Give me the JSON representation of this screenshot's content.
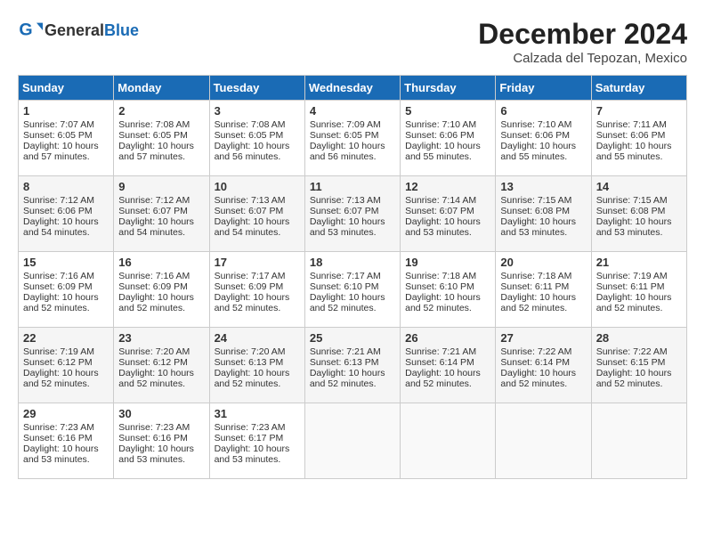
{
  "header": {
    "logo_general": "General",
    "logo_blue": "Blue",
    "main_title": "December 2024",
    "sub_title": "Calzada del Tepozan, Mexico"
  },
  "weekdays": [
    "Sunday",
    "Monday",
    "Tuesday",
    "Wednesday",
    "Thursday",
    "Friday",
    "Saturday"
  ],
  "weeks": [
    [
      {
        "day": "1",
        "sunrise": "Sunrise: 7:07 AM",
        "sunset": "Sunset: 6:05 PM",
        "daylight": "Daylight: 10 hours and 57 minutes."
      },
      {
        "day": "2",
        "sunrise": "Sunrise: 7:08 AM",
        "sunset": "Sunset: 6:05 PM",
        "daylight": "Daylight: 10 hours and 57 minutes."
      },
      {
        "day": "3",
        "sunrise": "Sunrise: 7:08 AM",
        "sunset": "Sunset: 6:05 PM",
        "daylight": "Daylight: 10 hours and 56 minutes."
      },
      {
        "day": "4",
        "sunrise": "Sunrise: 7:09 AM",
        "sunset": "Sunset: 6:05 PM",
        "daylight": "Daylight: 10 hours and 56 minutes."
      },
      {
        "day": "5",
        "sunrise": "Sunrise: 7:10 AM",
        "sunset": "Sunset: 6:06 PM",
        "daylight": "Daylight: 10 hours and 55 minutes."
      },
      {
        "day": "6",
        "sunrise": "Sunrise: 7:10 AM",
        "sunset": "Sunset: 6:06 PM",
        "daylight": "Daylight: 10 hours and 55 minutes."
      },
      {
        "day": "7",
        "sunrise": "Sunrise: 7:11 AM",
        "sunset": "Sunset: 6:06 PM",
        "daylight": "Daylight: 10 hours and 55 minutes."
      }
    ],
    [
      {
        "day": "8",
        "sunrise": "Sunrise: 7:12 AM",
        "sunset": "Sunset: 6:06 PM",
        "daylight": "Daylight: 10 hours and 54 minutes."
      },
      {
        "day": "9",
        "sunrise": "Sunrise: 7:12 AM",
        "sunset": "Sunset: 6:07 PM",
        "daylight": "Daylight: 10 hours and 54 minutes."
      },
      {
        "day": "10",
        "sunrise": "Sunrise: 7:13 AM",
        "sunset": "Sunset: 6:07 PM",
        "daylight": "Daylight: 10 hours and 54 minutes."
      },
      {
        "day": "11",
        "sunrise": "Sunrise: 7:13 AM",
        "sunset": "Sunset: 6:07 PM",
        "daylight": "Daylight: 10 hours and 53 minutes."
      },
      {
        "day": "12",
        "sunrise": "Sunrise: 7:14 AM",
        "sunset": "Sunset: 6:07 PM",
        "daylight": "Daylight: 10 hours and 53 minutes."
      },
      {
        "day": "13",
        "sunrise": "Sunrise: 7:15 AM",
        "sunset": "Sunset: 6:08 PM",
        "daylight": "Daylight: 10 hours and 53 minutes."
      },
      {
        "day": "14",
        "sunrise": "Sunrise: 7:15 AM",
        "sunset": "Sunset: 6:08 PM",
        "daylight": "Daylight: 10 hours and 53 minutes."
      }
    ],
    [
      {
        "day": "15",
        "sunrise": "Sunrise: 7:16 AM",
        "sunset": "Sunset: 6:09 PM",
        "daylight": "Daylight: 10 hours and 52 minutes."
      },
      {
        "day": "16",
        "sunrise": "Sunrise: 7:16 AM",
        "sunset": "Sunset: 6:09 PM",
        "daylight": "Daylight: 10 hours and 52 minutes."
      },
      {
        "day": "17",
        "sunrise": "Sunrise: 7:17 AM",
        "sunset": "Sunset: 6:09 PM",
        "daylight": "Daylight: 10 hours and 52 minutes."
      },
      {
        "day": "18",
        "sunrise": "Sunrise: 7:17 AM",
        "sunset": "Sunset: 6:10 PM",
        "daylight": "Daylight: 10 hours and 52 minutes."
      },
      {
        "day": "19",
        "sunrise": "Sunrise: 7:18 AM",
        "sunset": "Sunset: 6:10 PM",
        "daylight": "Daylight: 10 hours and 52 minutes."
      },
      {
        "day": "20",
        "sunrise": "Sunrise: 7:18 AM",
        "sunset": "Sunset: 6:11 PM",
        "daylight": "Daylight: 10 hours and 52 minutes."
      },
      {
        "day": "21",
        "sunrise": "Sunrise: 7:19 AM",
        "sunset": "Sunset: 6:11 PM",
        "daylight": "Daylight: 10 hours and 52 minutes."
      }
    ],
    [
      {
        "day": "22",
        "sunrise": "Sunrise: 7:19 AM",
        "sunset": "Sunset: 6:12 PM",
        "daylight": "Daylight: 10 hours and 52 minutes."
      },
      {
        "day": "23",
        "sunrise": "Sunrise: 7:20 AM",
        "sunset": "Sunset: 6:12 PM",
        "daylight": "Daylight: 10 hours and 52 minutes."
      },
      {
        "day": "24",
        "sunrise": "Sunrise: 7:20 AM",
        "sunset": "Sunset: 6:13 PM",
        "daylight": "Daylight: 10 hours and 52 minutes."
      },
      {
        "day": "25",
        "sunrise": "Sunrise: 7:21 AM",
        "sunset": "Sunset: 6:13 PM",
        "daylight": "Daylight: 10 hours and 52 minutes."
      },
      {
        "day": "26",
        "sunrise": "Sunrise: 7:21 AM",
        "sunset": "Sunset: 6:14 PM",
        "daylight": "Daylight: 10 hours and 52 minutes."
      },
      {
        "day": "27",
        "sunrise": "Sunrise: 7:22 AM",
        "sunset": "Sunset: 6:14 PM",
        "daylight": "Daylight: 10 hours and 52 minutes."
      },
      {
        "day": "28",
        "sunrise": "Sunrise: 7:22 AM",
        "sunset": "Sunset: 6:15 PM",
        "daylight": "Daylight: 10 hours and 52 minutes."
      }
    ],
    [
      {
        "day": "29",
        "sunrise": "Sunrise: 7:23 AM",
        "sunset": "Sunset: 6:16 PM",
        "daylight": "Daylight: 10 hours and 53 minutes."
      },
      {
        "day": "30",
        "sunrise": "Sunrise: 7:23 AM",
        "sunset": "Sunset: 6:16 PM",
        "daylight": "Daylight: 10 hours and 53 minutes."
      },
      {
        "day": "31",
        "sunrise": "Sunrise: 7:23 AM",
        "sunset": "Sunset: 6:17 PM",
        "daylight": "Daylight: 10 hours and 53 minutes."
      },
      null,
      null,
      null,
      null
    ]
  ]
}
